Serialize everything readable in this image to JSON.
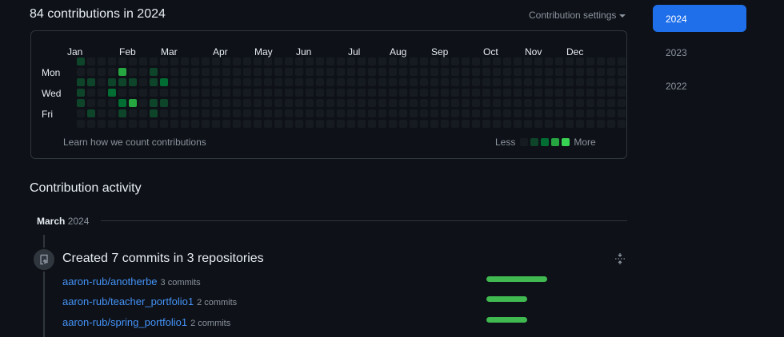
{
  "header": {
    "headline": "84 contributions in 2024",
    "settings_label": "Contribution settings"
  },
  "calendar": {
    "months": [
      "Jan",
      "Feb",
      "Mar",
      "Apr",
      "May",
      "Jun",
      "Jul",
      "Aug",
      "Sep",
      "Oct",
      "Nov",
      "Dec"
    ],
    "days": [
      "Mon",
      "Wed",
      "Fri"
    ],
    "weeks": 53,
    "levels": [
      "#161b22",
      "#0e4429",
      "#006d32",
      "#26a641",
      "#39d353"
    ],
    "active_cells": [
      {
        "week": 0,
        "day": 0,
        "level": 1
      },
      {
        "week": 0,
        "day": 2,
        "level": 1
      },
      {
        "week": 0,
        "day": 3,
        "level": 1
      },
      {
        "week": 0,
        "day": 4,
        "level": 1
      },
      {
        "week": 1,
        "day": 2,
        "level": 1
      },
      {
        "week": 1,
        "day": 5,
        "level": 1
      },
      {
        "week": 3,
        "day": 2,
        "level": 1
      },
      {
        "week": 3,
        "day": 3,
        "level": 2
      },
      {
        "week": 4,
        "day": 1,
        "level": 3
      },
      {
        "week": 4,
        "day": 2,
        "level": 1
      },
      {
        "week": 4,
        "day": 4,
        "level": 2
      },
      {
        "week": 4,
        "day": 5,
        "level": 1
      },
      {
        "week": 5,
        "day": 2,
        "level": 1
      },
      {
        "week": 5,
        "day": 4,
        "level": 3
      },
      {
        "week": 7,
        "day": 1,
        "level": 1
      },
      {
        "week": 7,
        "day": 2,
        "level": 1
      },
      {
        "week": 7,
        "day": 4,
        "level": 1
      },
      {
        "week": 7,
        "day": 5,
        "level": 1
      },
      {
        "week": 8,
        "day": 2,
        "level": 2
      },
      {
        "week": 8,
        "day": 4,
        "level": 1
      }
    ],
    "learn_link": "Learn how we count contributions",
    "legend_less": "Less",
    "legend_more": "More"
  },
  "years": [
    "2024",
    "2023",
    "2022"
  ],
  "selected_year": "2024",
  "activity": {
    "title": "Contribution activity",
    "month": "March",
    "year": "2024",
    "event_title": "Created 7 commits in 3 repositories",
    "repos": [
      {
        "name": "aaron-rub/anotherbe",
        "commits": "3 commits",
        "share": 1.0
      },
      {
        "name": "aaron-rub/teacher_portfolio1",
        "commits": "2 commits",
        "share": 0.67
      },
      {
        "name": "aaron-rub/spring_portfolio1",
        "commits": "2 commits",
        "share": 0.67
      }
    ]
  }
}
